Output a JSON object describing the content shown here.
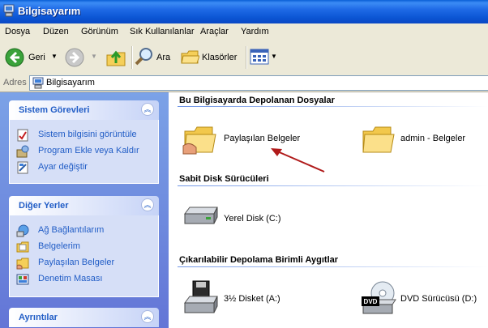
{
  "window": {
    "title": "Bilgisayarım"
  },
  "menu": [
    "Dosya",
    "Düzen",
    "Görünüm",
    "Sık Kullanılanlar",
    "Araçlar",
    "Yardım"
  ],
  "toolbar": {
    "back": "Geri",
    "search": "Ara",
    "folders": "Klasörler"
  },
  "address": {
    "label": "Adres",
    "value": "Bilgisayarım"
  },
  "panels": {
    "system": {
      "title": "Sistem Görevleri",
      "items": [
        "Sistem bilgisini görüntüle",
        "Program Ekle veya Kaldır",
        "Ayar değiştir"
      ]
    },
    "other": {
      "title": "Diğer Yerler",
      "items": [
        "Ağ Bağlantılarım",
        "Belgelerim",
        "Paylaşılan Belgeler",
        "Denetim Masası"
      ]
    },
    "details": {
      "title": "Ayrıntılar"
    }
  },
  "groups": {
    "stored": {
      "title": "Bu Bilgisayarda Depolanan Dosyalar",
      "items": [
        "Paylaşılan Belgeler",
        "admin - Belgeler"
      ]
    },
    "hdd": {
      "title": "Sabit Disk Sürücüleri",
      "items": [
        "Yerel Disk (C:)"
      ]
    },
    "removable": {
      "title": "Çıkarılabilir Depolama Birimli Aygıtlar",
      "items": [
        "3½ Disket (A:)",
        "DVD Sürücüsü (D:)"
      ]
    }
  },
  "dvd_icon_text": "DVD",
  "colors": {
    "title_bar": "#0b55d4",
    "left_pane": "#6375d6",
    "link": "#215dc6",
    "arrow": "#b01a1a"
  }
}
